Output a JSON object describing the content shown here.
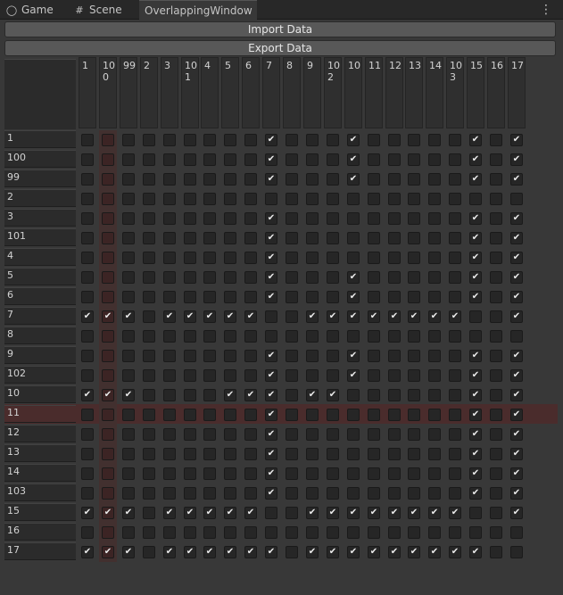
{
  "tabs": [
    {
      "label": "Game",
      "icon": "gamepad-icon"
    },
    {
      "label": "Scene",
      "icon": "grid-icon"
    },
    {
      "label": "OverlappingWindow",
      "icon": ""
    }
  ],
  "menu_icon": "kebab-menu-icon",
  "buttons": {
    "import_label": "Import Data",
    "export_label": "Export Data"
  },
  "columns": [
    "1",
    "100",
    "99",
    "2",
    "3",
    "101",
    "4",
    "5",
    "6",
    "7",
    "8",
    "9",
    "102",
    "10",
    "11",
    "12",
    "13",
    "14",
    "103",
    "15",
    "16",
    "17"
  ],
  "rows": [
    "1",
    "100",
    "99",
    "2",
    "3",
    "101",
    "4",
    "5",
    "6",
    "7",
    "8",
    "9",
    "102",
    "10",
    "11",
    "12",
    "13",
    "14",
    "103",
    "15",
    "16",
    "17"
  ],
  "highlight": {
    "row": "11",
    "column": "100"
  },
  "matrix": [
    [
      0,
      0,
      0,
      0,
      0,
      0,
      0,
      0,
      0,
      1,
      0,
      0,
      0,
      1,
      0,
      0,
      0,
      0,
      0,
      1,
      0,
      1
    ],
    [
      0,
      0,
      0,
      0,
      0,
      0,
      0,
      0,
      0,
      1,
      0,
      0,
      0,
      1,
      0,
      0,
      0,
      0,
      0,
      1,
      0,
      1
    ],
    [
      0,
      0,
      0,
      0,
      0,
      0,
      0,
      0,
      0,
      1,
      0,
      0,
      0,
      1,
      0,
      0,
      0,
      0,
      0,
      1,
      0,
      1
    ],
    [
      0,
      0,
      0,
      0,
      0,
      0,
      0,
      0,
      0,
      0,
      0,
      0,
      0,
      0,
      0,
      0,
      0,
      0,
      0,
      0,
      0,
      0
    ],
    [
      0,
      0,
      0,
      0,
      0,
      0,
      0,
      0,
      0,
      1,
      0,
      0,
      0,
      0,
      0,
      0,
      0,
      0,
      0,
      1,
      0,
      1
    ],
    [
      0,
      0,
      0,
      0,
      0,
      0,
      0,
      0,
      0,
      1,
      0,
      0,
      0,
      0,
      0,
      0,
      0,
      0,
      0,
      1,
      0,
      1
    ],
    [
      0,
      0,
      0,
      0,
      0,
      0,
      0,
      0,
      0,
      1,
      0,
      0,
      0,
      0,
      0,
      0,
      0,
      0,
      0,
      1,
      0,
      1
    ],
    [
      0,
      0,
      0,
      0,
      0,
      0,
      0,
      0,
      0,
      1,
      0,
      0,
      0,
      1,
      0,
      0,
      0,
      0,
      0,
      1,
      0,
      1
    ],
    [
      0,
      0,
      0,
      0,
      0,
      0,
      0,
      0,
      0,
      1,
      0,
      0,
      0,
      1,
      0,
      0,
      0,
      0,
      0,
      1,
      0,
      1
    ],
    [
      1,
      1,
      1,
      0,
      1,
      1,
      1,
      1,
      1,
      0,
      0,
      1,
      1,
      1,
      1,
      1,
      1,
      1,
      1,
      0,
      0,
      1
    ],
    [
      0,
      0,
      0,
      0,
      0,
      0,
      0,
      0,
      0,
      0,
      0,
      0,
      0,
      0,
      0,
      0,
      0,
      0,
      0,
      0,
      0,
      0
    ],
    [
      0,
      0,
      0,
      0,
      0,
      0,
      0,
      0,
      0,
      1,
      0,
      0,
      0,
      1,
      0,
      0,
      0,
      0,
      0,
      1,
      0,
      1
    ],
    [
      0,
      0,
      0,
      0,
      0,
      0,
      0,
      0,
      0,
      1,
      0,
      0,
      0,
      1,
      0,
      0,
      0,
      0,
      0,
      1,
      0,
      1
    ],
    [
      1,
      1,
      1,
      0,
      0,
      0,
      0,
      1,
      1,
      1,
      0,
      1,
      1,
      0,
      0,
      0,
      0,
      0,
      0,
      1,
      0,
      1
    ],
    [
      0,
      0,
      0,
      0,
      0,
      0,
      0,
      0,
      0,
      1,
      0,
      0,
      0,
      0,
      0,
      0,
      0,
      0,
      0,
      1,
      0,
      1
    ],
    [
      0,
      0,
      0,
      0,
      0,
      0,
      0,
      0,
      0,
      1,
      0,
      0,
      0,
      0,
      0,
      0,
      0,
      0,
      0,
      1,
      0,
      1
    ],
    [
      0,
      0,
      0,
      0,
      0,
      0,
      0,
      0,
      0,
      1,
      0,
      0,
      0,
      0,
      0,
      0,
      0,
      0,
      0,
      1,
      0,
      1
    ],
    [
      0,
      0,
      0,
      0,
      0,
      0,
      0,
      0,
      0,
      1,
      0,
      0,
      0,
      0,
      0,
      0,
      0,
      0,
      0,
      1,
      0,
      1
    ],
    [
      0,
      0,
      0,
      0,
      0,
      0,
      0,
      0,
      0,
      1,
      0,
      0,
      0,
      0,
      0,
      0,
      0,
      0,
      0,
      1,
      0,
      1
    ],
    [
      1,
      1,
      1,
      0,
      1,
      1,
      1,
      1,
      1,
      0,
      0,
      1,
      1,
      1,
      1,
      1,
      1,
      1,
      1,
      0,
      0,
      1
    ],
    [
      0,
      0,
      0,
      0,
      0,
      0,
      0,
      0,
      0,
      0,
      0,
      0,
      0,
      0,
      0,
      0,
      0,
      0,
      0,
      0,
      0,
      0
    ],
    [
      1,
      1,
      1,
      0,
      1,
      1,
      1,
      1,
      1,
      1,
      0,
      1,
      1,
      1,
      1,
      1,
      1,
      1,
      1,
      1,
      0,
      0
    ]
  ]
}
